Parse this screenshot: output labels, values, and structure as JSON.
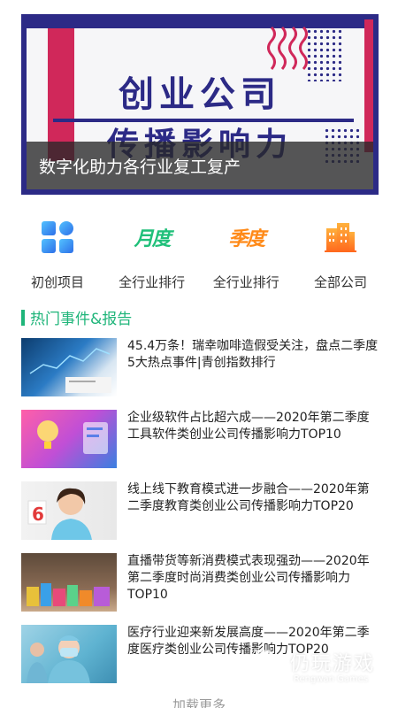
{
  "banner": {
    "title_line1": "创业公司",
    "title_line2": "传播影响力",
    "caption": "数字化助力各行业复工复产"
  },
  "nav": [
    {
      "label": "初创项目",
      "icon": "grid-icon"
    },
    {
      "label": "全行业排行",
      "icon": "monthly-icon",
      "icon_text": "月度"
    },
    {
      "label": "全行业排行",
      "icon": "quarterly-icon",
      "icon_text": "季度"
    },
    {
      "label": "全部公司",
      "icon": "building-icon"
    }
  ],
  "section": {
    "title": "热门事件&报告"
  },
  "articles": [
    {
      "title": "45.4万条！瑞幸咖啡造假受关注，盘点二季度5大热点事件|青创指数排行"
    },
    {
      "title": "企业级软件占比超六成——2020年第二季度工具软件类创业公司传播影响力TOP10"
    },
    {
      "title": "线上线下教育模式进一步融合——2020年第二季度教育类创业公司传播影响力TOP20"
    },
    {
      "title": "直播带货等新消费模式表现强劲——2020年第二季度时尚消费类创业公司传播影响力TOP10"
    },
    {
      "title": "医疗行业迎来新发展高度——2020年第二季度医疗类创业公司传播影响力TOP20"
    }
  ],
  "load_more": "加载更多",
  "watermark": {
    "cn": "仍玩游戏",
    "en": "Rengwan Games"
  },
  "colors": {
    "accent": "#1fb57a",
    "banner_navy": "#2c2a86",
    "banner_red": "#d0285a"
  }
}
